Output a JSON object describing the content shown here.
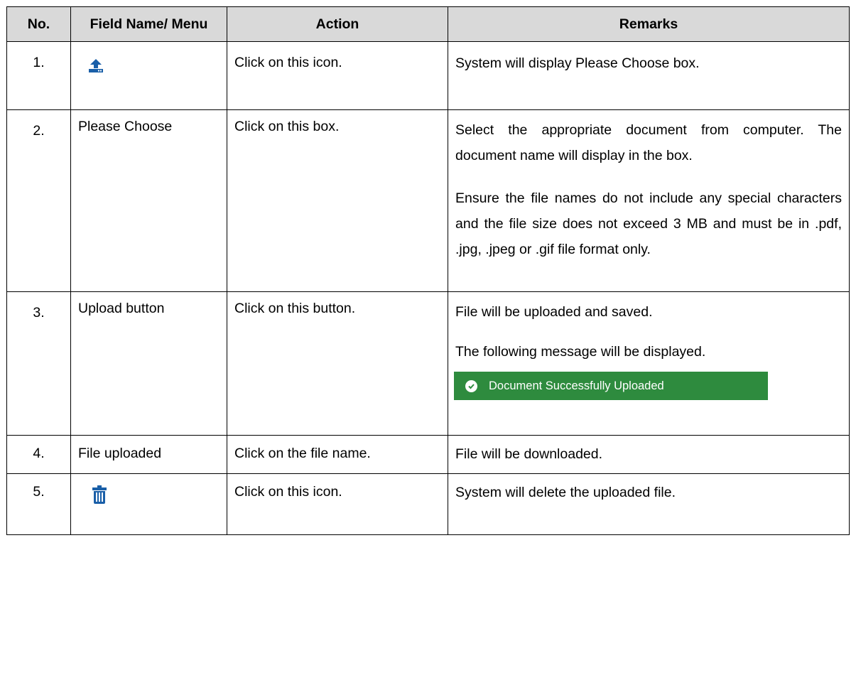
{
  "headers": {
    "no": "No.",
    "field": "Field Name/ Menu",
    "action": "Action",
    "remarks": "Remarks"
  },
  "rows": [
    {
      "no": "1.",
      "field_icon": "upload-icon",
      "action": "Click on this icon.",
      "remarks": [
        "System will display Please Choose box."
      ]
    },
    {
      "no": "2.",
      "field": "Please Choose",
      "action": "Click on this box.",
      "remarks": [
        "Select the appropriate document from computer. The document name will display in the box.",
        "Ensure the file names do not include any special characters and the file size does not exceed 3 MB and must be in .pdf, .jpg, .jpeg or .gif file format only."
      ]
    },
    {
      "no": "3.",
      "field": "Upload button",
      "action": "Click on this button.",
      "remarks": [
        "File will be uploaded and saved.",
        "The following message will be displayed."
      ],
      "message": "Document Successfully Uploaded"
    },
    {
      "no": "4.",
      "field": "File uploaded",
      "action": "Click on the file name.",
      "remarks": [
        "File will be downloaded."
      ]
    },
    {
      "no": "5.",
      "field_icon": "trash-icon",
      "action": "Click on this icon.",
      "remarks": [
        "System will delete the uploaded file."
      ]
    }
  ],
  "colors": {
    "header_bg": "#d9d9d9",
    "success_bg": "#2e8b3e",
    "icon_blue": "#1a5fa8"
  }
}
